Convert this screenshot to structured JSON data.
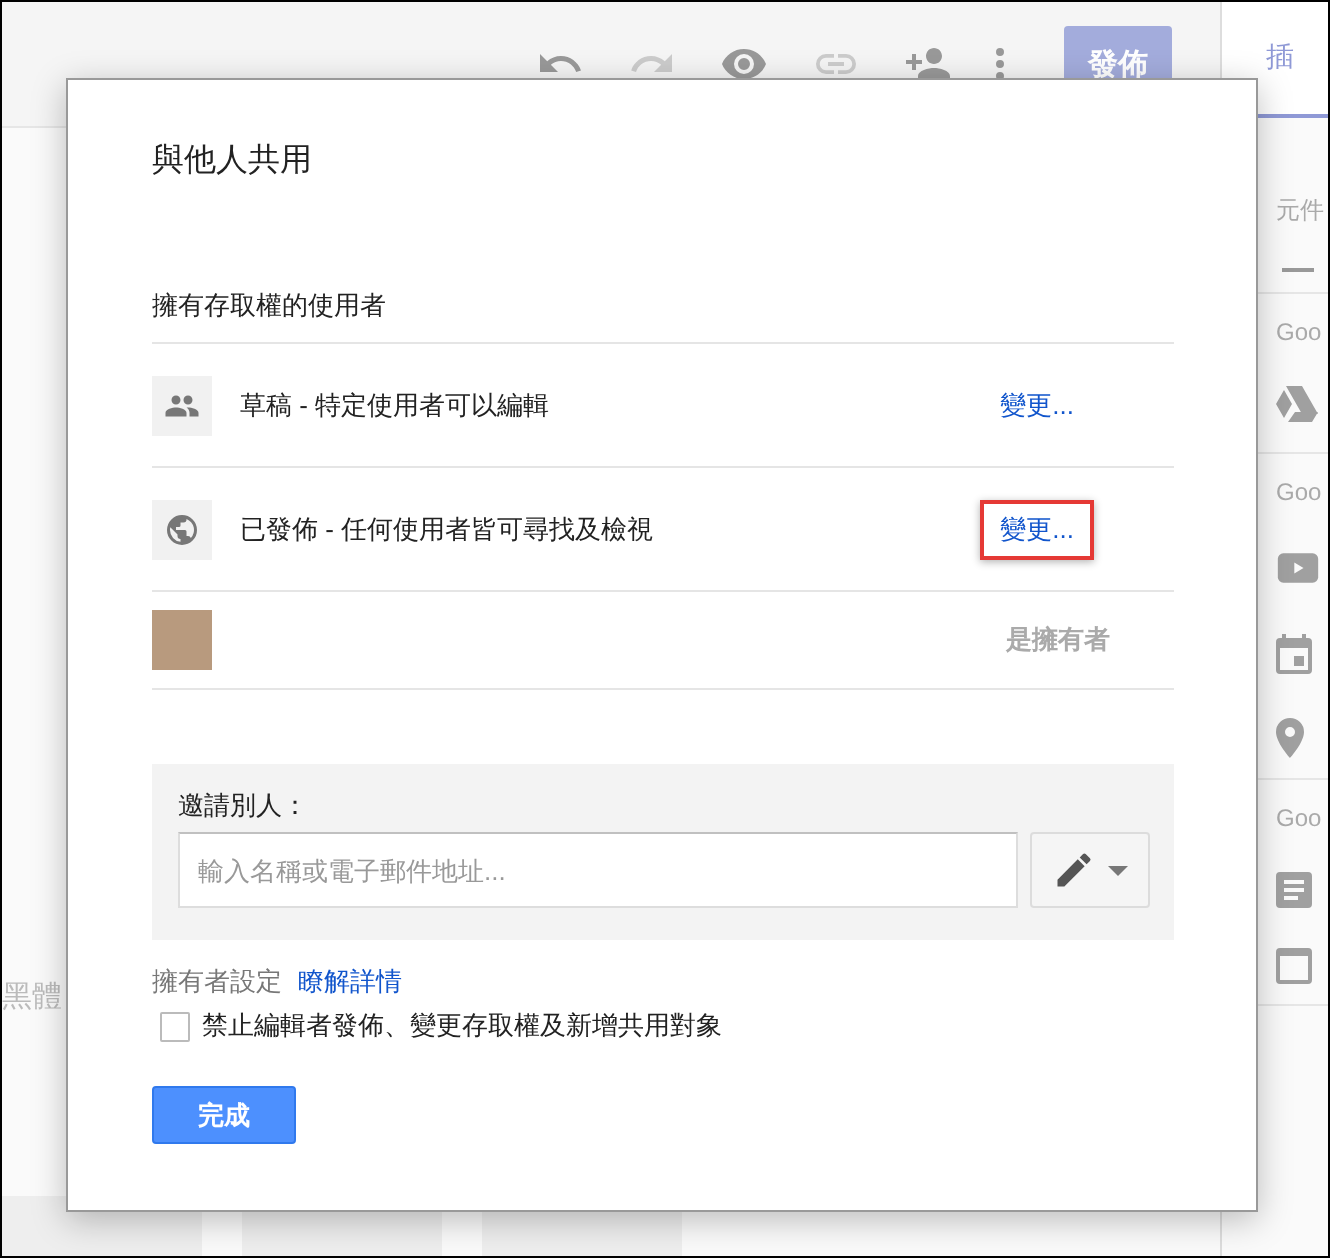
{
  "editor": {
    "publish_button": "發佈",
    "canvas_text": "黑體"
  },
  "side_panel": {
    "tab": {
      "label": "插",
      "selected": true
    },
    "sections": [
      {
        "heading": "元件",
        "kind": "divider-only"
      },
      {
        "heading": "Goo",
        "kind": "drive"
      },
      {
        "heading": "Goo",
        "kind": "media"
      },
      {
        "heading": "Goo",
        "kind": "docs"
      }
    ]
  },
  "dialog": {
    "title": "與他人共用",
    "access_heading": "擁有存取權的使用者",
    "entries": [
      {
        "kind": "group",
        "text": "草稿 - 特定使用者可以編輯",
        "action": "變更...",
        "highlighted": false
      },
      {
        "kind": "public",
        "text": "已發佈 - 任何使用者皆可尋找及檢視",
        "action": "變更...",
        "highlighted": true
      },
      {
        "kind": "owner",
        "role": "是擁有者"
      }
    ],
    "invite": {
      "label": "邀請別人：",
      "placeholder": "輸入名稱或電子郵件地址..."
    },
    "owner_settings": {
      "label": "擁有者設定",
      "link": "瞭解詳情"
    },
    "restrict": {
      "label": "禁止編輯者發佈、變更存取權及新增共用對象",
      "checked": false
    },
    "done_button": "完成"
  }
}
